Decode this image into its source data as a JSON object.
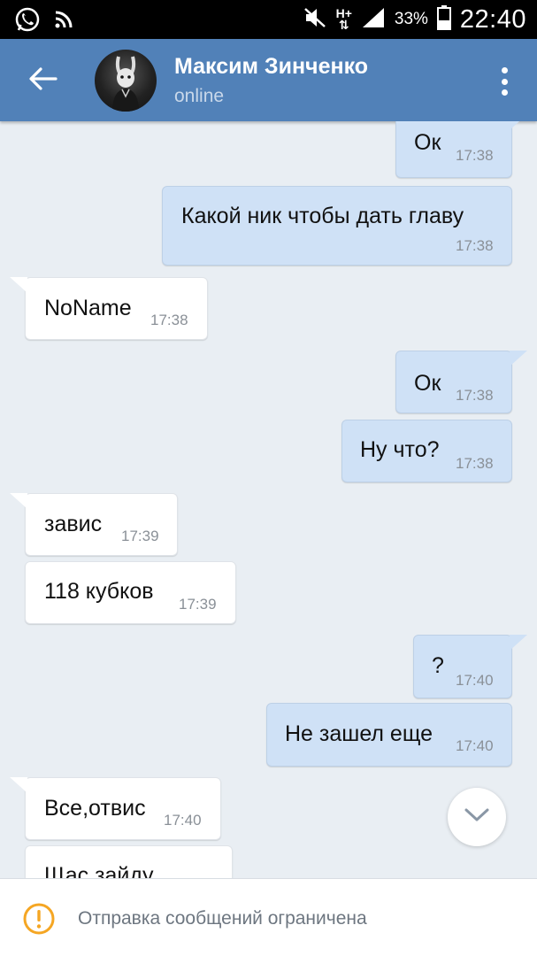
{
  "status_bar": {
    "battery": "33%",
    "time": "22:40",
    "network": "H+",
    "icons": [
      "whatsapp-icon",
      "rss-icon",
      "mute-icon",
      "network-h-plus-icon",
      "signal-icon",
      "battery-icon"
    ]
  },
  "header": {
    "contact_name": "Максим Зинченко",
    "status": "online",
    "color": "#5181b8",
    "icons": [
      "back-arrow-icon",
      "avatar",
      "more-vertical-icon"
    ]
  },
  "messages": [
    {
      "direction": "out",
      "text": "Ок",
      "time": "17:38"
    },
    {
      "direction": "out",
      "text": "Какой ник чтобы дать главу",
      "time": "17:38"
    },
    {
      "direction": "in",
      "text": "NoName",
      "time": "17:38"
    },
    {
      "direction": "out",
      "text": "Ок",
      "time": "17:38"
    },
    {
      "direction": "out",
      "text": "Ну что?",
      "time": "17:38"
    },
    {
      "direction": "in",
      "text": "завис",
      "time": "17:39"
    },
    {
      "direction": "in",
      "text": "118 кубков",
      "time": "17:39"
    },
    {
      "direction": "out",
      "text": "?",
      "time": "17:40"
    },
    {
      "direction": "out",
      "text": "Не зашел еще",
      "time": "17:40"
    },
    {
      "direction": "in",
      "text": "Все,отвис",
      "time": "17:40"
    },
    {
      "direction": "in",
      "text": "Щас зайду",
      "time": ""
    }
  ],
  "bottom_bar": {
    "notice": "Отправка сообщений ограничена",
    "icon": "warning-icon",
    "icon_color": "#f5a623"
  },
  "colors": {
    "outgoing_bubble": "#cfe1f6",
    "incoming_bubble": "#ffffff",
    "chat_background": "#e9eef3"
  }
}
